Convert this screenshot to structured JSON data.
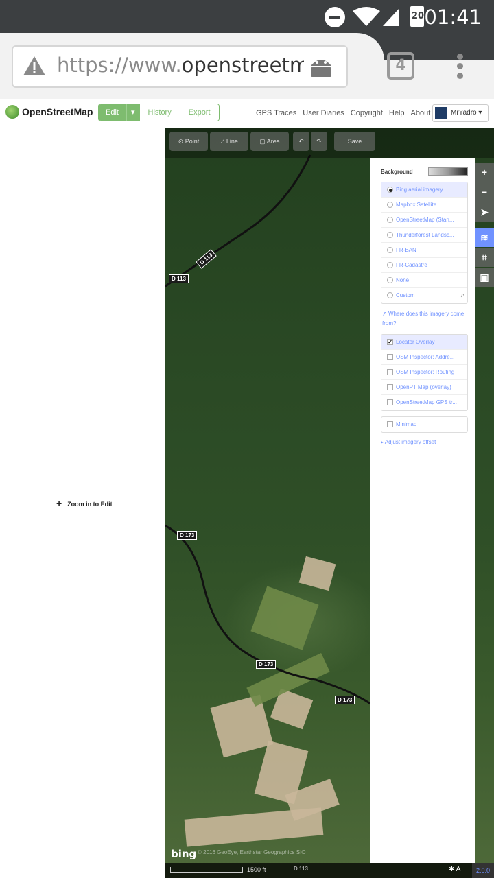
{
  "statusbar": {
    "time": "01:41",
    "battery": "20"
  },
  "browser": {
    "url_prefix": "https://www.",
    "url_domain": "openstreetma",
    "tab_count": "4"
  },
  "header": {
    "brand": "OpenStreetMap",
    "edit": "Edit",
    "history": "History",
    "export": "Export",
    "nav": [
      "GPS Traces",
      "User Diaries",
      "Copyright",
      "Help",
      "About"
    ],
    "user": "MrYadro"
  },
  "toolbar": {
    "point": "Point",
    "line": "Line",
    "area": "Area",
    "save": "Save"
  },
  "sidebar": {
    "zoom_to_edit": "Zoom in to Edit"
  },
  "background_panel": {
    "title": "Background",
    "imagery": [
      {
        "label": "Bing aerial imagery",
        "selected": true
      },
      {
        "label": "Mapbox Satellite",
        "selected": false
      },
      {
        "label": "OpenStreetMap (Stan...",
        "selected": false
      },
      {
        "label": "Thunderforest Landsc...",
        "selected": false
      },
      {
        "label": "FR-BAN",
        "selected": false
      },
      {
        "label": "FR-Cadastre",
        "selected": false
      },
      {
        "label": "None",
        "selected": false
      },
      {
        "label": "Custom",
        "selected": false
      }
    ],
    "where_link": "Where does this imagery come from?",
    "overlays": [
      {
        "label": "Locator Overlay",
        "checked": true
      },
      {
        "label": "OSM Inspector: Addre...",
        "checked": false
      },
      {
        "label": "OSM Inspector: Routing",
        "checked": false
      },
      {
        "label": "OpenPT Map (overlay)",
        "checked": false
      },
      {
        "label": "OpenStreetMap GPS tr...",
        "checked": false
      }
    ],
    "minimap": "Minimap",
    "adjust_offset": "Adjust imagery offset"
  },
  "road_labels": {
    "d113_a": "D 113",
    "d113_b": "D 113",
    "d173_a": "D 173",
    "d173_b": "D 173",
    "d173_c": "D 173",
    "d113_c": "D 113"
  },
  "footer": {
    "bing": "bing",
    "attribution": "© 2016 GeoEye, Earthstar Geographics SIO",
    "scale": "1500 ft",
    "version": "2.0.0"
  },
  "colors": {
    "osm_green": "#7ebc6f",
    "ideditor_blue": "#7092ff",
    "status_bar": "#3c3f41"
  }
}
